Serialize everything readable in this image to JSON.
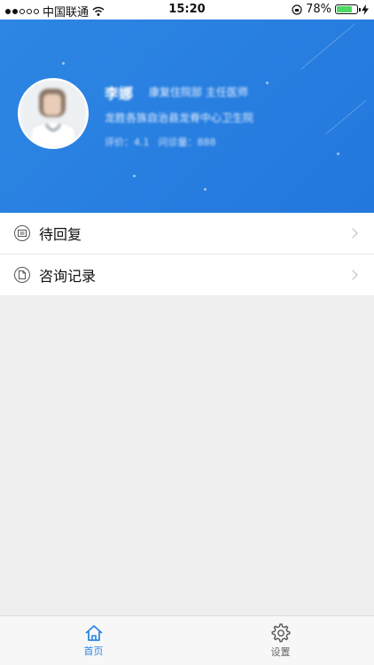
{
  "status_bar": {
    "carrier": "中国联通",
    "time": "15:20",
    "battery_percent": "78%",
    "battery_level": 0.78,
    "signal_filled": 2,
    "signal_total": 5
  },
  "colors": {
    "primary": "#2d86e3",
    "battery_green": "#4cd964",
    "background": "#efefef"
  },
  "profile": {
    "name": "李娜",
    "title": "康复住院部 主任医师",
    "hospital": "龙胜各族自治县龙脊中心卫生院",
    "rating": "评价：4.1",
    "consultations": "问诊量：888"
  },
  "menu": {
    "items": [
      {
        "label": "待回复",
        "icon": "message-icon"
      },
      {
        "label": "咨询记录",
        "icon": "document-icon"
      }
    ]
  },
  "tabs": [
    {
      "label": "首页",
      "icon": "home-icon",
      "active": true
    },
    {
      "label": "设置",
      "icon": "gear-icon",
      "active": false
    }
  ]
}
